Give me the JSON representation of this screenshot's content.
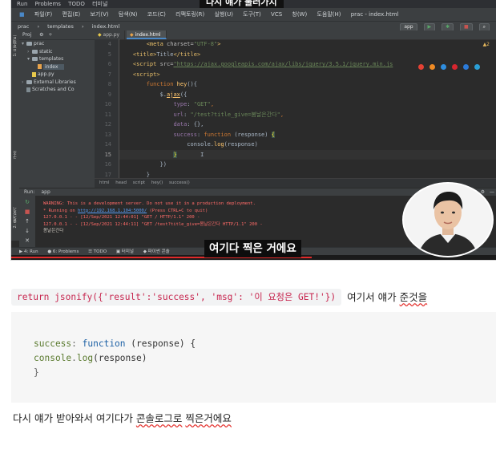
{
  "video": {
    "top_caption": "다시 얘가 불러가지",
    "top_strip_items": [
      "Run",
      "Problems",
      "TODO",
      "터미널"
    ],
    "subtitle": "여기다 찍은 거에요",
    "progress_fraction": 0.62
  },
  "ide": {
    "menu_items": [
      "파일(F)",
      "편집(E)",
      "보기(V)",
      "탐색(N)",
      "코드(C)",
      "리팩토링(R)",
      "실행(U)",
      "도구(T)",
      "VCS",
      "창(W)",
      "도움말(H)",
      "prac - index.html"
    ],
    "path_crumbs": [
      "prac",
      "templates",
      "index.html"
    ],
    "right_tools": [
      "app"
    ],
    "side_tabs": [
      "1: 프로젝트",
      "2: 즐겨찾기",
      "구조"
    ],
    "project_pane": {
      "header": "Proj",
      "rows": [
        {
          "indent": 0,
          "arrow": "▾",
          "kind": "folder",
          "label": "prac"
        },
        {
          "indent": 1,
          "arrow": "›",
          "kind": "folder",
          "label": "static"
        },
        {
          "indent": 1,
          "arrow": "▾",
          "kind": "folder",
          "label": "templates"
        },
        {
          "indent": 2,
          "arrow": "",
          "kind": "html",
          "label": "index"
        },
        {
          "indent": 1,
          "arrow": "",
          "kind": "py",
          "label": "app.py"
        },
        {
          "indent": 0,
          "arrow": "›",
          "kind": "folder",
          "label": "External Libraries"
        },
        {
          "indent": 0,
          "arrow": "",
          "kind": "scratch",
          "label": "Scratches and Co"
        }
      ]
    },
    "editor_tabs": [
      {
        "label": "app.py",
        "active": false
      },
      {
        "label": "index.html",
        "active": true
      }
    ],
    "warning_count": "▲2",
    "line_numbers": [
      "4",
      "5",
      "6",
      "7",
      "8",
      "9",
      "10",
      "11",
      "12",
      "13",
      "14",
      "15",
      "16",
      "17"
    ],
    "current_line_index": 11,
    "code": {
      "l4_tag_open": "<meta ",
      "l4_attr": "charset=",
      "l4_str": "\"UTF-8\"",
      "l4_tag_close": ">",
      "l5_tag_open": "<title>",
      "l5_text": "Title",
      "l5_tag_close": "</title>",
      "l6_tag_open": "<script ",
      "l6_attr": "src=",
      "l6_str": "\"https://ajax.googleapis.com/ajax/libs/jquery/3.5.1/jquery.min.js",
      "l7_tag": "<script>",
      "l8_kw": "function ",
      "l8_fn": "hey",
      "l8_rest": "(){",
      "l9_obj": "$.",
      "l9_fn": "ajax",
      "l9_rest": "({",
      "l10_prop": "type",
      "l10_colon": ": ",
      "l10_str": "\"GET\"",
      "l10_comma": ",",
      "l11_prop": "url",
      "l11_colon": ": ",
      "l11_str": "\"/test?title_give=봄날은간다\"",
      "l11_comma": ",",
      "l12_prop": "data",
      "l12_rest": ": {},",
      "l13_prop": "success",
      "l13_colon": ": ",
      "l13_kw": "function ",
      "l13_rest": "(response) ",
      "l13_brace": "{",
      "l14_obj": "console.",
      "l14_fn": "log",
      "l14_rest": "(response)",
      "l15_brace": "}",
      "l16_rest": "})",
      "l17_rest": "}"
    },
    "crumbs": [
      "html",
      "head",
      "script",
      "hey()",
      "success()"
    ],
    "run_header": [
      "Run:",
      "app"
    ],
    "console_lines": [
      {
        "cls": "red",
        "text": "WARNING: This is a development server. Do not use it in a production deployment."
      },
      {
        "cls": "red",
        "text": "* Running on ",
        "link": "http://192.168.1.104:5000/",
        "after": " (Press CTRL+C to quit)"
      },
      {
        "cls": "red",
        "text": "127.0.0.1 - - [12/Sep/2021 12:44:01] \"GET / HTTP/1.1\" 200 -"
      },
      {
        "cls": "red",
        "text": "127.0.0.1 - - [12/Sep/2021 12:44:11] \"GET /test?title_give=봄날은간다 HTTP/1.1\" 200 -"
      },
      {
        "cls": "plain",
        "text": "봄날은간다"
      }
    ],
    "bottom_bar_items": [
      "▶ 4: Run",
      "● 6: Problems",
      "☰ TODO",
      "▣ 터미널",
      "◆ 파이썬 콘솔"
    ]
  },
  "inline_code": {
    "code": "return jsonify({'result':'success', 'msg': '이 요청은 GET!'})",
    "after_prefix": "여기서 얘가 ",
    "after_underlined": "준것을"
  },
  "code_block": {
    "line1_prop": "success",
    "line1_colon": ": ",
    "line1_kw": "function",
    "line1_rest": " (response) {",
    "line2_obj": "console",
    "line2_dot": ".",
    "line2_fn": "log",
    "line2_rest": "(response)",
    "line3": "}"
  },
  "bottom_sentence": {
    "prefix": "다시 얘가 받아와서 여기다가 ",
    "underlined_1": "콘솔로그로",
    "space": " ",
    "underlined_2": "찍은거에요"
  },
  "colors": {
    "ide_bg": "#2b2b2b",
    "inline_code_text": "#c7254e",
    "code_block_bg": "#f6f6f6",
    "progress_red": "#e12a2a"
  }
}
